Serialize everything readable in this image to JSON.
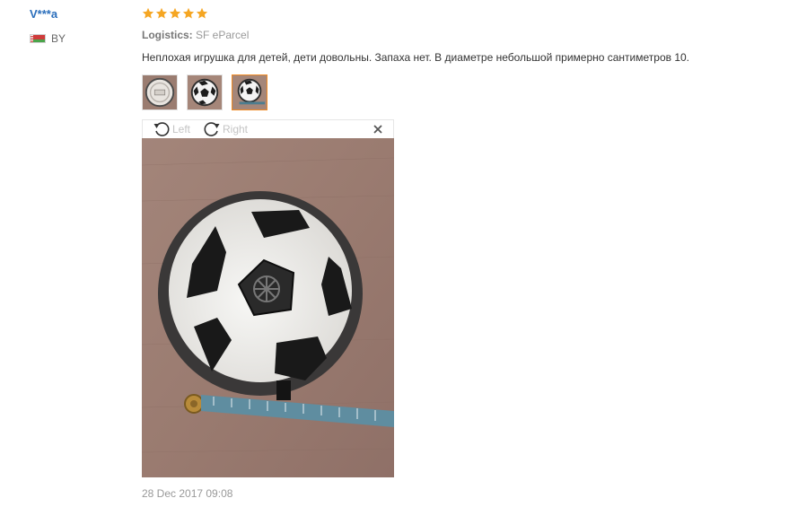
{
  "user": {
    "name": "V***a",
    "country_code": "BY"
  },
  "review": {
    "rating": 5,
    "logistics_label": "Logistics:",
    "logistics_value": "SF eParcel",
    "text": "Неплохая игрушка для детей, дети довольны. Запаха нет. В диаметре небольшой примерно сантиметров 10.",
    "timestamp": "28 Dec 2017 09:08"
  },
  "thumbnails": [
    {
      "icon": "ball-bottom-view-thumbnail",
      "active": false
    },
    {
      "icon": "ball-top-view-thumbnail",
      "active": false
    },
    {
      "icon": "ball-with-tape-thumbnail",
      "active": true
    }
  ],
  "viewer": {
    "rotate_left_label": "Left",
    "rotate_right_label": "Right",
    "close_icon": "close-icon"
  },
  "colors": {
    "username": "#2a6ebb",
    "star": "#f5a623",
    "active_thumb_border": "#f08a24",
    "muted_text": "#999999"
  }
}
